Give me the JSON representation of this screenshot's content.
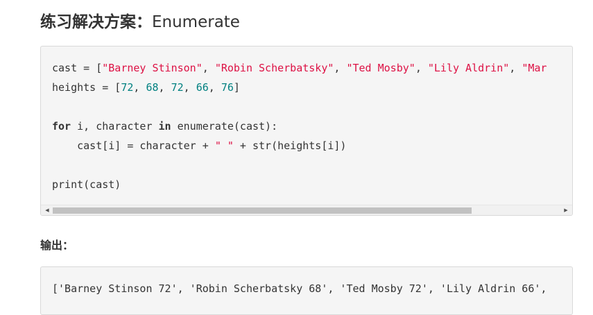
{
  "heading": {
    "cjk": "练习解决方案：",
    "latin": "Enumerate"
  },
  "code": {
    "line1": {
      "prefix": "cast = [",
      "s1": "\"Barney Stinson\"",
      "sep1": ", ",
      "s2": "\"Robin Scherbatsky\"",
      "sep2": ", ",
      "s3": "\"Ted Mosby\"",
      "sep3": ", ",
      "s4": "\"Lily Aldrin\"",
      "sep4": ", ",
      "s5": "\"Mar"
    },
    "line2": {
      "prefix": "heights = [",
      "n1": "72",
      "sep1": ", ",
      "n2": "68",
      "sep2": ", ",
      "n3": "72",
      "sep3": ", ",
      "n4": "66",
      "sep4": ", ",
      "n5": "76",
      "suffix": "]"
    },
    "line4": {
      "kw_for": "for",
      "mid": " i, character ",
      "kw_in": "in",
      "rest": " enumerate(cast):"
    },
    "line5": {
      "prefix": "    cast[i] = character + ",
      "str": "\" \"",
      "suffix": " + str(heights[i])"
    },
    "line7": {
      "text": "print(cast)"
    }
  },
  "scrollbar": {
    "left_arrow": "◀",
    "right_arrow": "▶",
    "position_fraction": 0.0,
    "visible_fraction": 0.79
  },
  "output_heading": "输出：",
  "output": {
    "text": "['Barney Stinson 72', 'Robin Scherbatsky 68', 'Ted Mosby 72', 'Lily Aldrin 66', "
  }
}
